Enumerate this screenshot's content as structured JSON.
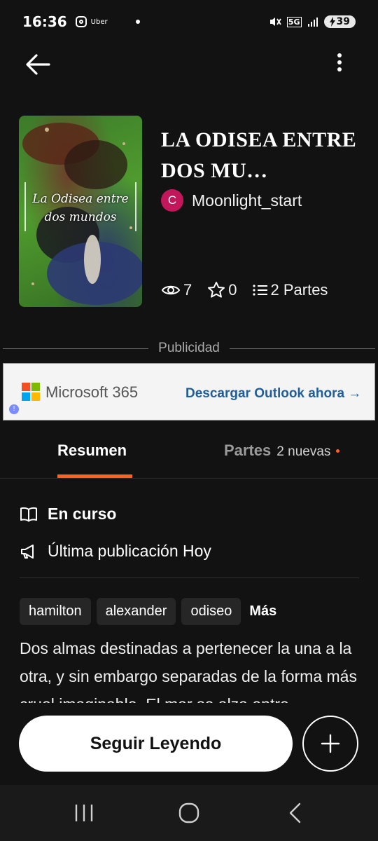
{
  "status_bar": {
    "time": "16:36",
    "app_label": "Uber",
    "network": "5G",
    "battery": "39"
  },
  "book": {
    "cover_title": "La Odisea entre dos mundos",
    "title": "LA ODISEA ENTRE DOS MU…",
    "author_initial": "C",
    "author": "Moonlight_start",
    "views": "7",
    "votes": "0",
    "parts": "2 Partes"
  },
  "ad": {
    "label": "Publicidad",
    "brand": "Microsoft 365",
    "cta": "Descargar Outlook ahora →",
    "info_glyph": "!"
  },
  "tabs": {
    "summary": "Resumen",
    "parts": "Partes",
    "parts_badge": "2 nuevas"
  },
  "details": {
    "status": "En curso",
    "last_update": "Última publicación Hoy"
  },
  "tags": [
    "hamilton",
    "alexander",
    "odiseo"
  ],
  "tags_more": "Más",
  "description": "Dos almas destinadas a pertenecer la una a la otra, y sin embargo separadas de la forma más cruel imaginable. El mar se alza entre",
  "cta": {
    "continue": "Seguir Leyendo"
  },
  "colors": {
    "accent": "#ff6122",
    "background": "#121212",
    "avatar": "#c2185b",
    "ad_link": "#1f5d9b"
  },
  "icons": [
    "back-arrow-icon",
    "more-vertical-icon",
    "eye-icon",
    "star-icon",
    "list-icon",
    "open-book-icon",
    "megaphone-icon",
    "plus-icon",
    "recents-icon",
    "home-icon",
    "nav-back-icon"
  ]
}
